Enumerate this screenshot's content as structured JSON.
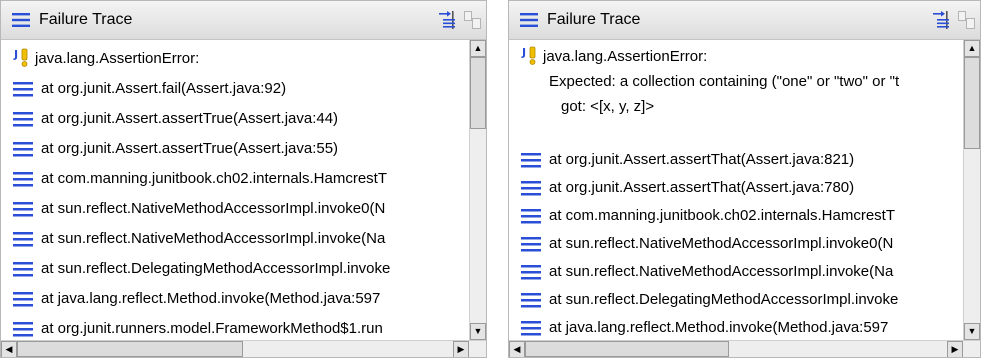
{
  "colors": {
    "accent": "#2a4fd6",
    "warning": "#e8b400",
    "titlebar": "#e4e4e4"
  },
  "icons": {
    "view": "list-lines-icon",
    "filter": "filter-stack-trace-icon",
    "compare": "compare-results-icon",
    "assertion": "junit-failure-icon",
    "frame": "stack-frame-icon"
  },
  "left_panel": {
    "title": "Failure Trace",
    "lines": [
      "java.lang.AssertionError:",
      "at org.junit.Assert.fail(Assert.java:92)",
      "at org.junit.Assert.assertTrue(Assert.java:44)",
      "at org.junit.Assert.assertTrue(Assert.java:55)",
      "at com.manning.junitbook.ch02.internals.HamcrestT",
      "at sun.reflect.NativeMethodAccessorImpl.invoke0(N",
      "at sun.reflect.NativeMethodAccessorImpl.invoke(Na",
      "at sun.reflect.DelegatingMethodAccessorImpl.invoke",
      "at java.lang.reflect.Method.invoke(Method.java:597",
      "at org.junit.runners.model.FrameworkMethod$1.run"
    ]
  },
  "right_panel": {
    "title": "Failure Trace",
    "error": "java.lang.AssertionError:",
    "expected": "Expected: a collection containing (\"one\" or \"two\" or \"t",
    "got": "got: <[x, y, z]>",
    "lines": [
      "at org.junit.Assert.assertThat(Assert.java:821)",
      "at org.junit.Assert.assertThat(Assert.java:780)",
      "at com.manning.junitbook.ch02.internals.HamcrestT",
      "at sun.reflect.NativeMethodAccessorImpl.invoke0(N",
      "at sun.reflect.NativeMethodAccessorImpl.invoke(Na",
      "at sun.reflect.DelegatingMethodAccessorImpl.invoke",
      "at java.lang.reflect.Method.invoke(Method.java:597"
    ]
  }
}
